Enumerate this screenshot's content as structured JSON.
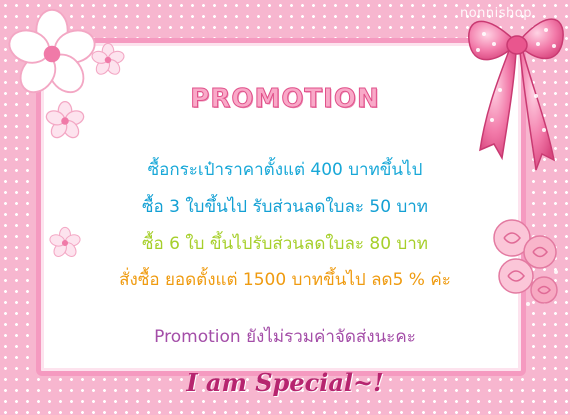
{
  "watermark": "nonnishop",
  "title": "PROMOTION",
  "lines": [
    "ซื้อกระเป๋าราคาตั้งแต่ 400 บาทขึ้นไป",
    "ซื้อ 3 ใบขึ้นไป รับส่วนลดใบละ 50 บาท",
    "ซื้อ 6 ใบ ขึ้นไปรับส่วนลดใบละ 80 บาท",
    "สั่งซื้อ ยอดตั้งแต่ 1500 บาทขึ้นไป ลด5 % ค่ะ"
  ],
  "note": "Promotion ยังไม่รวมค่าจัดส่งนะคะ",
  "tagline": "I am Special~!",
  "colors": {
    "frame": "#f7b6cf",
    "border": "#f59ac0",
    "title": "#f9a9c8",
    "line1": "#18a8d8",
    "line3": "#a6cf2a",
    "line4": "#ef9b10",
    "note": "#a44ea8",
    "tagline": "#b6256f"
  },
  "icons": [
    "cherry-blossom-icon",
    "ribbon-bow-icon",
    "rose-bouquet-icon"
  ]
}
